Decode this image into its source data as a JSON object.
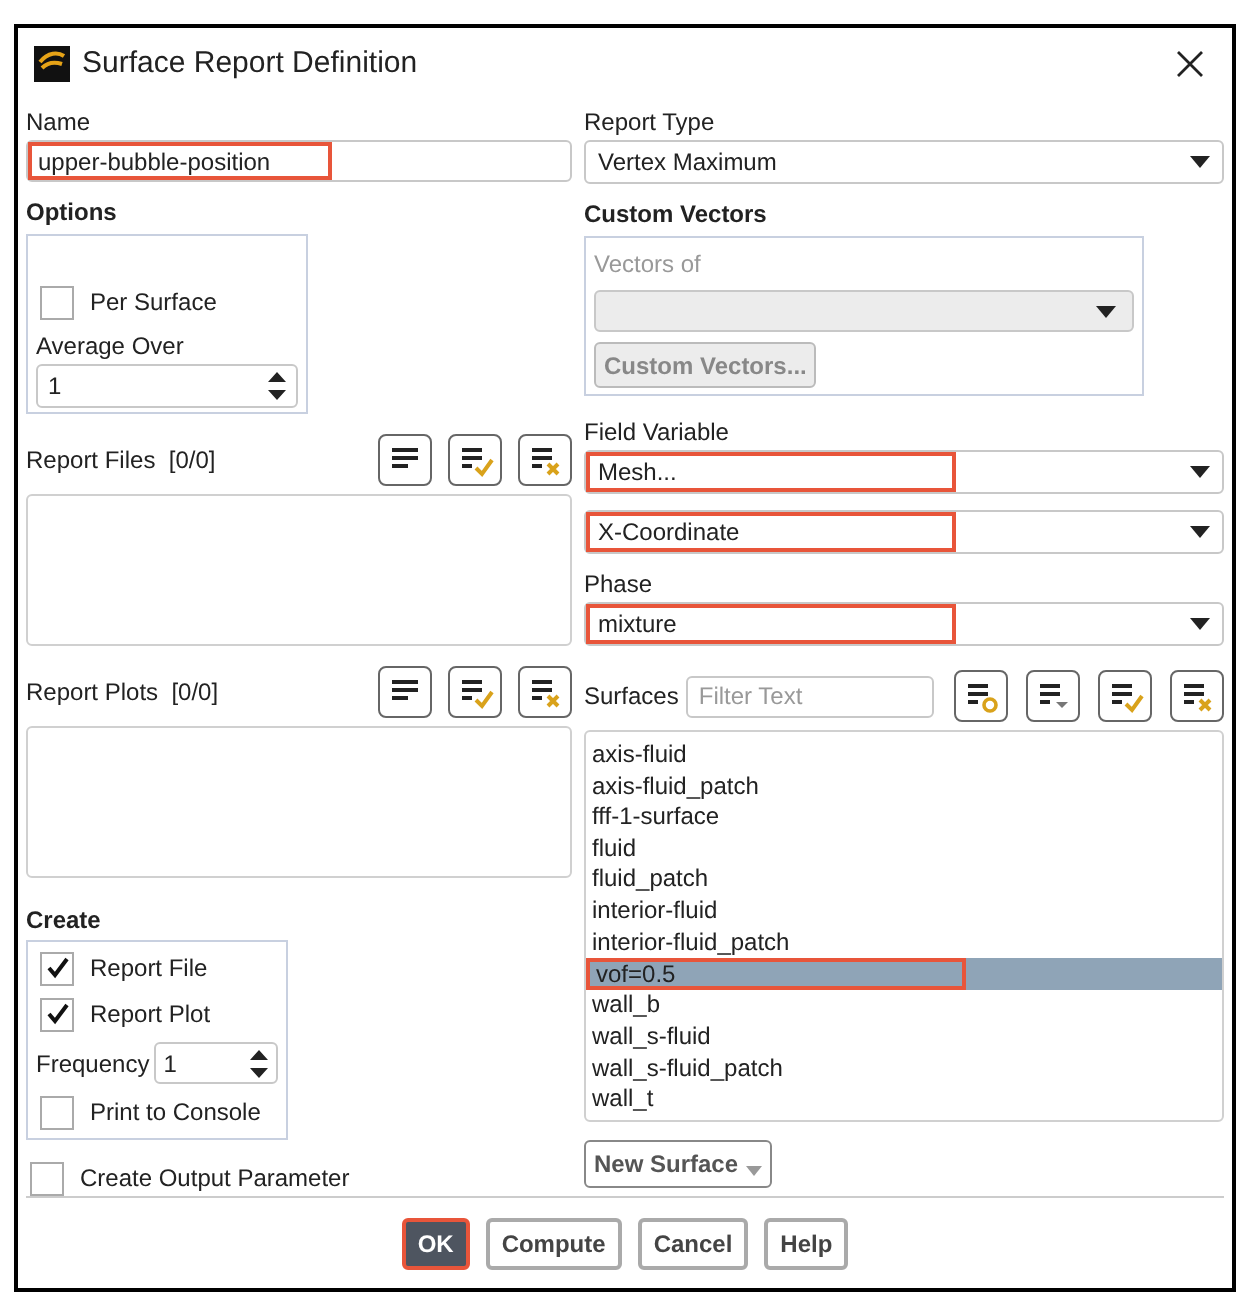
{
  "window": {
    "title": "Surface Report Definition"
  },
  "name": {
    "label": "Name",
    "value": "upper-bubble-position",
    "highlighted": true
  },
  "options": {
    "title": "Options",
    "per_surface": {
      "label": "Per Surface",
      "checked": false
    },
    "average_over": {
      "label": "Average Over",
      "value": "1"
    }
  },
  "report_files": {
    "label": "Report Files",
    "count": "[0/0]"
  },
  "report_plots": {
    "label": "Report Plots",
    "count": "[0/0]"
  },
  "create": {
    "title": "Create",
    "items": [
      {
        "kind": "checkbox",
        "label": "Report File",
        "checked": true
      },
      {
        "kind": "checkbox",
        "label": "Report Plot",
        "checked": true
      },
      {
        "kind": "spinner",
        "label": "Frequency",
        "value": "1"
      },
      {
        "kind": "checkbox",
        "label": "Print to Console",
        "checked": false
      }
    ]
  },
  "create_output_parameter": {
    "label": "Create Output Parameter",
    "checked": false
  },
  "report_type": {
    "label": "Report Type",
    "value": "Vertex Maximum"
  },
  "custom_vectors": {
    "title": "Custom Vectors",
    "vectors_of_label": "Vectors of",
    "button": "Custom Vectors...",
    "disabled": true
  },
  "field_variable": {
    "label": "Field Variable",
    "dropdowns": [
      {
        "value": "Mesh...",
        "highlighted": true
      },
      {
        "value": "X-Coordinate",
        "highlighted": true
      }
    ]
  },
  "phase": {
    "label": "Phase",
    "value": "mixture",
    "highlighted": true
  },
  "surfaces": {
    "label": "Surfaces",
    "placeholder": "Filter Text",
    "items": [
      {
        "label": "axis-fluid",
        "selected": false,
        "highlighted": false
      },
      {
        "label": "axis-fluid_patch",
        "selected": false,
        "highlighted": false
      },
      {
        "label": "fff-1-surface",
        "selected": false,
        "highlighted": false
      },
      {
        "label": "fluid",
        "selected": false,
        "highlighted": false
      },
      {
        "label": "fluid_patch",
        "selected": false,
        "highlighted": false
      },
      {
        "label": "interior-fluid",
        "selected": false,
        "highlighted": false
      },
      {
        "label": "interior-fluid_patch",
        "selected": false,
        "highlighted": false
      },
      {
        "label": "vof=0.5",
        "selected": true,
        "highlighted": true
      },
      {
        "label": "wall_b",
        "selected": false,
        "highlighted": false
      },
      {
        "label": "wall_s-fluid",
        "selected": false,
        "highlighted": false
      },
      {
        "label": "wall_s-fluid_patch",
        "selected": false,
        "highlighted": false
      },
      {
        "label": "wall_t",
        "selected": false,
        "highlighted": false
      }
    ],
    "new_surface_button": "New Surface"
  },
  "buttons": [
    {
      "label": "OK",
      "default": true,
      "highlighted": true
    },
    {
      "label": "Compute",
      "default": false,
      "highlighted": false
    },
    {
      "label": "Cancel",
      "default": false,
      "highlighted": false
    },
    {
      "label": "Help",
      "default": false,
      "highlighted": false
    }
  ]
}
